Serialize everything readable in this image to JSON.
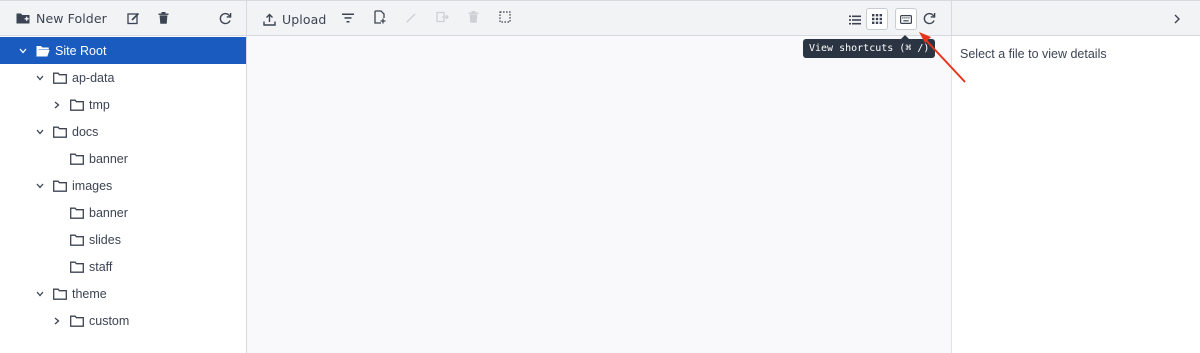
{
  "left_toolbar": {
    "new_folder_label": "New Folder"
  },
  "tree": [
    {
      "label": "Site Root",
      "level": 0,
      "chevron": "down",
      "selected": true
    },
    {
      "label": "ap-data",
      "level": 1,
      "chevron": "down",
      "selected": false
    },
    {
      "label": "tmp",
      "level": 2,
      "chevron": "right",
      "selected": false
    },
    {
      "label": "docs",
      "level": 1,
      "chevron": "down",
      "selected": false
    },
    {
      "label": "banner",
      "level": 2,
      "chevron": "none",
      "selected": false
    },
    {
      "label": "images",
      "level": 1,
      "chevron": "down",
      "selected": false
    },
    {
      "label": "banner",
      "level": 2,
      "chevron": "none",
      "selected": false
    },
    {
      "label": "slides",
      "level": 2,
      "chevron": "none",
      "selected": false
    },
    {
      "label": "staff",
      "level": 2,
      "chevron": "none",
      "selected": false
    },
    {
      "label": "theme",
      "level": 1,
      "chevron": "down",
      "selected": false
    },
    {
      "label": "custom",
      "level": 2,
      "chevron": "right",
      "selected": false
    }
  ],
  "main_toolbar": {
    "upload_label": "Upload"
  },
  "tooltip": {
    "text": "View shortcuts (⌘ /)"
  },
  "details": {
    "empty_message": "Select a file to view details"
  },
  "colors": {
    "selected_bg": "#1a5bbf",
    "toolbar_bg": "#f2f3f5",
    "annotation_arrow": "#e8331c"
  }
}
